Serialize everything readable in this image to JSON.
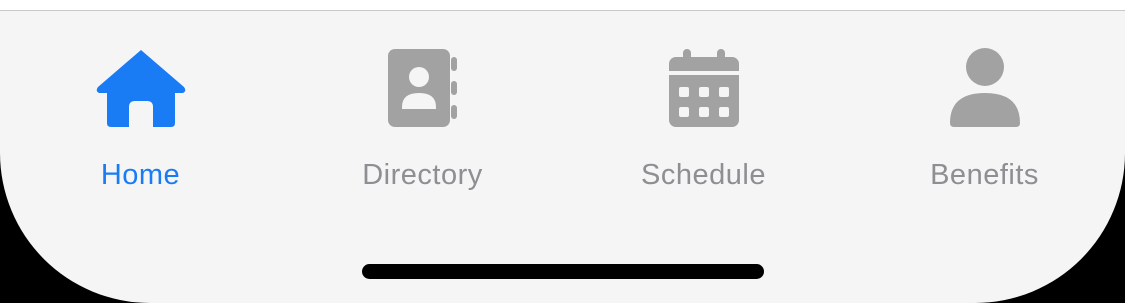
{
  "tab_bar": {
    "active_color": "#1a7cf5",
    "inactive_color": "#a2a2a2",
    "tabs": [
      {
        "label": "Home",
        "icon": "house-icon",
        "active": true
      },
      {
        "label": "Directory",
        "icon": "contact-book-icon",
        "active": false
      },
      {
        "label": "Schedule",
        "icon": "calendar-icon",
        "active": false
      },
      {
        "label": "Benefits",
        "icon": "person-icon",
        "active": false
      }
    ]
  }
}
